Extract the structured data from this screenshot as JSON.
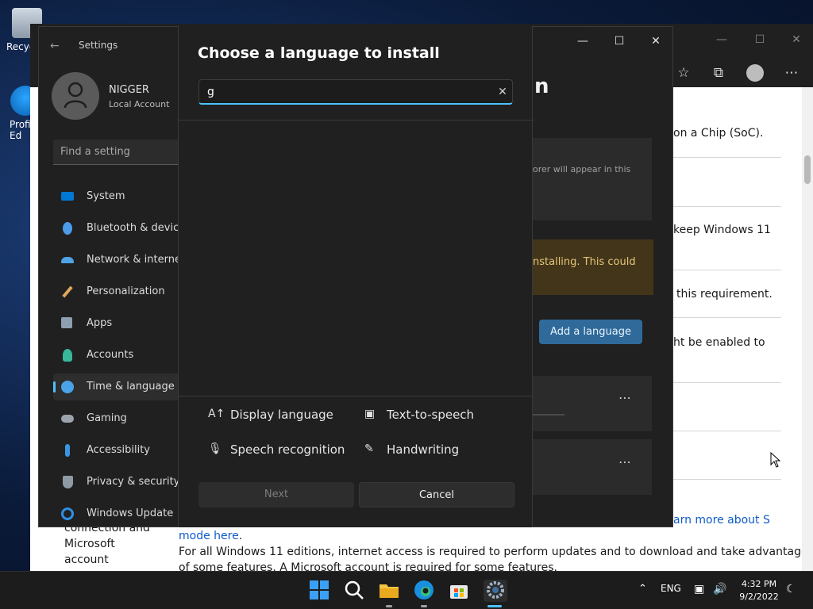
{
  "desktop": {
    "icons": [
      {
        "label": "Recyc"
      },
      {
        "label": "Profi\nEd"
      }
    ]
  },
  "browser": {
    "lines": [
      "on a Chip (SoC).",
      "keep Windows 11",
      "this requirement.",
      "ht be enabled to"
    ],
    "bottom": {
      "left_text_1": "connection and",
      "left_text_2": "Microsoft",
      "left_text_3": "account",
      "link_right": "arn more about S",
      "link_mode": "mode here",
      "period": ".",
      "paragraph_1": "For all Windows 11 editions, internet access is required to perform updates and to download and take advantage",
      "paragraph_2": "of some features. A Microsoft account is required for some features."
    }
  },
  "settings": {
    "title": "Settings",
    "user_name": "NIGGER",
    "user_sub": "Local Account",
    "find_placeholder": "Find a setting",
    "nav": [
      {
        "label": "System",
        "icon": "monitor-icon",
        "color": "#0078d4"
      },
      {
        "label": "Bluetooth & devices",
        "icon": "bluetooth-icon",
        "color": "#4c9be8"
      },
      {
        "label": "Network & internet",
        "icon": "wifi-icon",
        "color": "#4fa3e6"
      },
      {
        "label": "Personalization",
        "icon": "brush-icon",
        "color": "#e0a85a"
      },
      {
        "label": "Apps",
        "icon": "apps-icon",
        "color": "#8e9fb0"
      },
      {
        "label": "Accounts",
        "icon": "person-icon",
        "color": "#38b89a"
      },
      {
        "label": "Time & language",
        "icon": "globe-icon",
        "color": "#4aa3e8"
      },
      {
        "label": "Gaming",
        "icon": "gamepad-icon",
        "color": "#9ba3ad"
      },
      {
        "label": "Accessibility",
        "icon": "accessibility-icon",
        "color": "#3a94e0"
      },
      {
        "label": "Privacy & security",
        "icon": "shield-icon",
        "color": "#8e9aa6"
      },
      {
        "label": "Windows Update",
        "icon": "update-icon",
        "color": "#2f8ee5"
      }
    ],
    "heading_fragment": "n",
    "faint_text": "orer will appear in this",
    "warning_text": "nstalling. This could",
    "add_language_label": "Add a language"
  },
  "dialog": {
    "title": "Choose a language to install",
    "search_value": "g",
    "features": [
      {
        "label": "Display language",
        "icon": "display-language-icon",
        "glyph": "A↑"
      },
      {
        "label": "Text-to-speech",
        "icon": "text-to-speech-icon",
        "glyph": "▣"
      },
      {
        "label": "Speech recognition",
        "icon": "microphone-icon",
        "glyph": "🎙"
      },
      {
        "label": "Handwriting",
        "icon": "handwriting-icon",
        "glyph": "✎"
      }
    ],
    "next_label": "Next",
    "cancel_label": "Cancel"
  },
  "taskbar": {
    "language": "ENG",
    "time": "4:32 PM",
    "date": "9/2/2022"
  }
}
